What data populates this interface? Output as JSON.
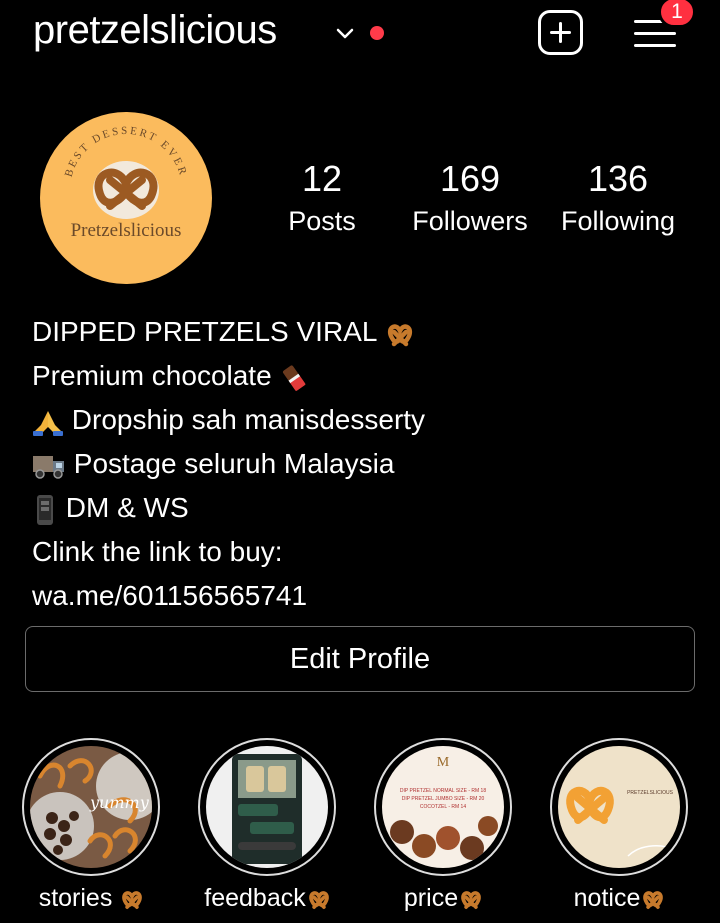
{
  "header": {
    "username": "pretzelslicious",
    "notification_count": "1"
  },
  "avatar": {
    "arc_text": "BEST DESSERT EVER",
    "brand_text": "Pretzelslicious"
  },
  "stats": [
    {
      "value": "12",
      "label": "Posts"
    },
    {
      "value": "169",
      "label": "Followers"
    },
    {
      "value": "136",
      "label": "Following"
    }
  ],
  "bio": {
    "line1": "DIPPED PRETZELS VIRAL",
    "line2": "Premium chocolate ",
    "line3": " Dropship sah manisdesserty",
    "line4": "Postage seluruh Malaysia",
    "line5": " DM & WS",
    "line6": "Clink the link to buy:",
    "link": "wa.me/601156565741"
  },
  "edit_profile_label": "Edit Profile",
  "highlights": [
    {
      "label": "stories "
    },
    {
      "label": "feedback"
    },
    {
      "label": "price"
    },
    {
      "label": "notice"
    }
  ],
  "highlight_thumbs": {
    "stories_overlay": "yummy",
    "price_lines": [
      "DIP PRETZEL NORMAL SIZE - RM 18",
      "DIP PRETZEL JUMBO SIZE - RM 20",
      "COCOTZEL - RM 14"
    ],
    "notice_brand": "PRETZELSLICIOUS"
  },
  "colors": {
    "background": "#000000",
    "avatar_bg": "#fbbb5d",
    "badge": "#ff3040",
    "pretzel": "#c77a2c"
  },
  "icons": [
    "chevron-down-icon",
    "new-post-icon",
    "menu-icon",
    "pretzel-emoji",
    "chocolate-emoji",
    "pray-emoji",
    "truck-emoji",
    "phone-emoji"
  ]
}
